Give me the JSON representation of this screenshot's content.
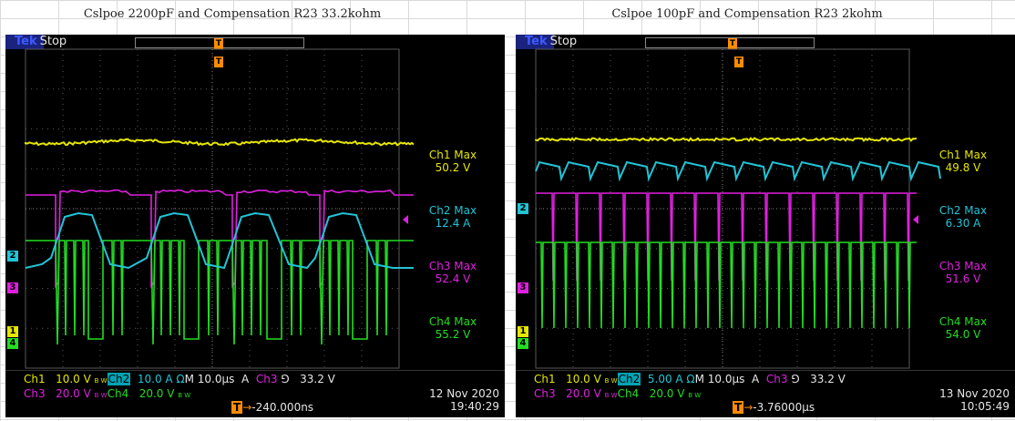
{
  "captions": {
    "left": "Cslpoe 2200pF and Compensation R23 33.2kohm",
    "right": "Cslpoe 100pF and Compensation R23 2kohm"
  },
  "colors": {
    "ch1": "#e6e600",
    "ch2": "#22c4d6",
    "ch3": "#e020e0",
    "ch4": "#22dd22",
    "trigger": "#ff8c00",
    "grid": "#5a5a5a"
  },
  "scopes": [
    {
      "status": "Stop",
      "meas": [
        {
          "name": "Ch1 Max",
          "value": "50.2 V"
        },
        {
          "name": "Ch2 Max",
          "value": "12.4 A"
        },
        {
          "name": "Ch3 Max",
          "value": "52.4 V"
        },
        {
          "name": "Ch4 Max",
          "value": "55.2 V"
        }
      ],
      "settings": {
        "ch1_label": "Ch1",
        "ch1_scale": "10.0 V",
        "ch2_label": "Ch2",
        "ch2_scale": "10.0 A Ω",
        "timebase": "M 10.0µs",
        "trig_mode": "A",
        "trig_src": "Ch3",
        "trig_slope": "⅁",
        "trig_level": "33.2 V",
        "ch3_label": "Ch3",
        "ch3_scale": "20.0 V",
        "ch4_label": "Ch4",
        "ch4_scale": "20.0 V",
        "trig_pos": "-240.000ns",
        "date": "12 Nov 2020",
        "time": "19:40:29"
      }
    },
    {
      "status": "Stop",
      "meas": [
        {
          "name": "Ch1 Max",
          "value": "49.8 V"
        },
        {
          "name": "Ch2 Max",
          "value": "6.30 A"
        },
        {
          "name": "Ch3 Max",
          "value": "51.6 V"
        },
        {
          "name": "Ch4 Max",
          "value": "54.0 V"
        }
      ],
      "settings": {
        "ch1_label": "Ch1",
        "ch1_scale": "10.0 V",
        "ch2_label": "Ch2",
        "ch2_scale": "5.00 A Ω",
        "timebase": "M 10.0µs",
        "trig_mode": "A",
        "trig_src": "Ch3",
        "trig_slope": "⅁",
        "trig_level": "33.2 V",
        "ch3_label": "Ch3",
        "ch3_scale": "20.0 V",
        "ch4_label": "Ch4",
        "ch4_scale": "20.0 V",
        "trig_pos": "-3.76000µs",
        "date": "13 Nov 2020",
        "time": "10:05:49"
      }
    }
  ],
  "markers": {
    "trig": "T",
    "ch1": "1",
    "ch2": "2",
    "ch3": "3",
    "ch4": "4",
    "bw": "B W"
  }
}
